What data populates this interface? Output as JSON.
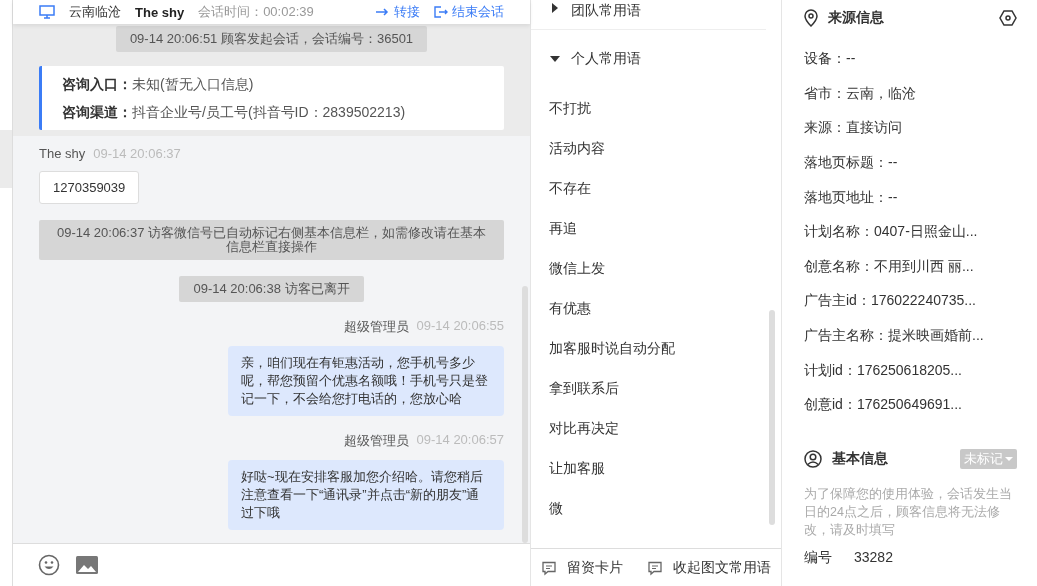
{
  "header": {
    "location": "云南临沧",
    "visitor": "The shy",
    "duration": "会话时间：00:02:39",
    "transfer": "转接",
    "end": "结束会话"
  },
  "chat": {
    "opening": [
      {
        "kind": "system",
        "text": "09-14 20:06:51 顾客发起会话，会话编号：36501"
      },
      {
        "kind": "info",
        "rows": [
          {
            "label": "咨询入口：",
            "value": "未知(暂无入口信息)"
          },
          {
            "label": "咨询渠道：",
            "value": "抖音企业号/员工号(抖音号ID：2839502213)"
          }
        ]
      }
    ],
    "messages": [
      {
        "kind": "visitor",
        "sender": "The shy",
        "time": "09-14 20:06:37",
        "text": "1270359039"
      },
      {
        "kind": "system",
        "text": "09-14 20:06:37 访客微信号已自动标记右侧基本信息栏，如需修改请在基本信息栏直接操作"
      },
      {
        "kind": "system",
        "text": "09-14 20:06:38 访客已离开"
      },
      {
        "kind": "agent",
        "sender": "超级管理员",
        "time": "09-14 20:06:55",
        "text": "亲，咱们现在有钜惠活动，您手机号多少呢，帮您预留个优惠名额哦！手机号只是登记一下，不会给您打电话的，您放心哈"
      },
      {
        "kind": "agent",
        "sender": "超级管理员",
        "time": "09-14 20:06:57",
        "text": "好哒~现在安排客服加您介绍哈。请您稍后注意查看一下“通讯录”并点击“新的朋友”通过下哦"
      }
    ]
  },
  "phrases": {
    "groups": [
      {
        "title": "团队常用语",
        "expanded": false
      },
      {
        "title": "个人常用语",
        "expanded": true,
        "items": [
          "不打扰",
          "活动内容",
          "不存在",
          "再追",
          "微信上发",
          "有优惠",
          "加客服时说自动分配",
          "拿到联系后",
          "对比再决定",
          "让加客服",
          "微"
        ]
      }
    ],
    "actions": [
      "留资卡片",
      "收起图文常用语"
    ]
  },
  "source_info": {
    "title": "来源信息",
    "fields": [
      "设备：--",
      "省市：云南，临沧",
      "来源：直接访问",
      "落地页标题：--",
      "落地页地址：--",
      "计划名称：0407-日照金山...",
      "创意名称：不用到川西 丽...",
      "广告主id：176022240735...",
      "广告主名称：提米映画婚前...",
      "计划id：176250618205...",
      "创意id：176250649691..."
    ]
  },
  "basic_info": {
    "title": "基本信息",
    "tag": "未标记",
    "note": "为了保障您的使用体验，会话发生当日的24点之后，顾客信息将无法修改，请及时填写",
    "fields": [
      {
        "label": "编号",
        "value": "33282"
      }
    ]
  }
}
